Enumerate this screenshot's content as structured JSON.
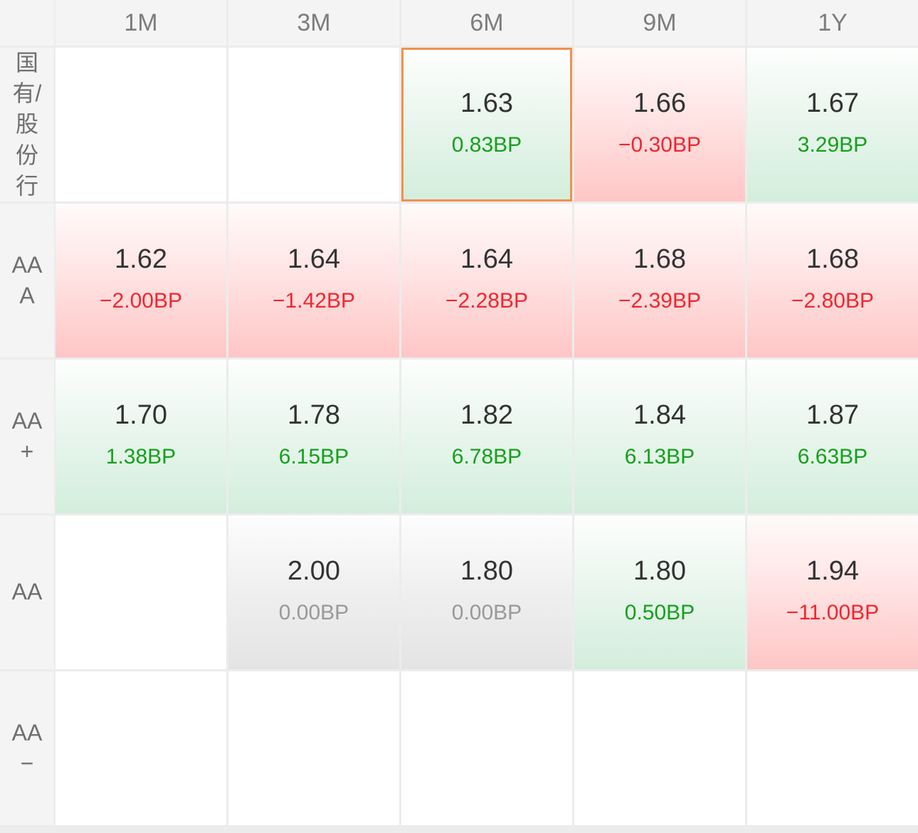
{
  "columns": [
    "1M",
    "3M",
    "6M",
    "9M",
    "1Y"
  ],
  "rows": [
    {
      "label": "国有/股份行",
      "cells": [
        null,
        null,
        {
          "rate": "1.63",
          "change": "0.83BP",
          "trend": "up",
          "selected": true
        },
        {
          "rate": "1.66",
          "change": "−0.30BP",
          "trend": "down"
        },
        {
          "rate": "1.67",
          "change": "3.29BP",
          "trend": "up"
        }
      ]
    },
    {
      "label": "AAA",
      "cells": [
        {
          "rate": "1.62",
          "change": "−2.00BP",
          "trend": "down"
        },
        {
          "rate": "1.64",
          "change": "−1.42BP",
          "trend": "down"
        },
        {
          "rate": "1.64",
          "change": "−2.28BP",
          "trend": "down"
        },
        {
          "rate": "1.68",
          "change": "−2.39BP",
          "trend": "down"
        },
        {
          "rate": "1.68",
          "change": "−2.80BP",
          "trend": "down"
        }
      ]
    },
    {
      "label": "AA+",
      "cells": [
        {
          "rate": "1.70",
          "change": "1.38BP",
          "trend": "up"
        },
        {
          "rate": "1.78",
          "change": "6.15BP",
          "trend": "up"
        },
        {
          "rate": "1.82",
          "change": "6.78BP",
          "trend": "up"
        },
        {
          "rate": "1.84",
          "change": "6.13BP",
          "trend": "up"
        },
        {
          "rate": "1.87",
          "change": "6.63BP",
          "trend": "up"
        }
      ]
    },
    {
      "label": "AA",
      "cells": [
        null,
        {
          "rate": "2.00",
          "change": "0.00BP",
          "trend": "flat"
        },
        {
          "rate": "1.80",
          "change": "0.00BP",
          "trend": "flat"
        },
        {
          "rate": "1.80",
          "change": "0.50BP",
          "trend": "up"
        },
        {
          "rate": "1.94",
          "change": "−11.00BP",
          "trend": "down"
        }
      ]
    },
    {
      "label": "AA−",
      "cells": [
        null,
        null,
        null,
        null,
        null
      ]
    }
  ],
  "colors": {
    "positive": "#15a01b",
    "negative": "#f0262d",
    "neutral": "#999999",
    "selected_border": "#f0914d"
  }
}
